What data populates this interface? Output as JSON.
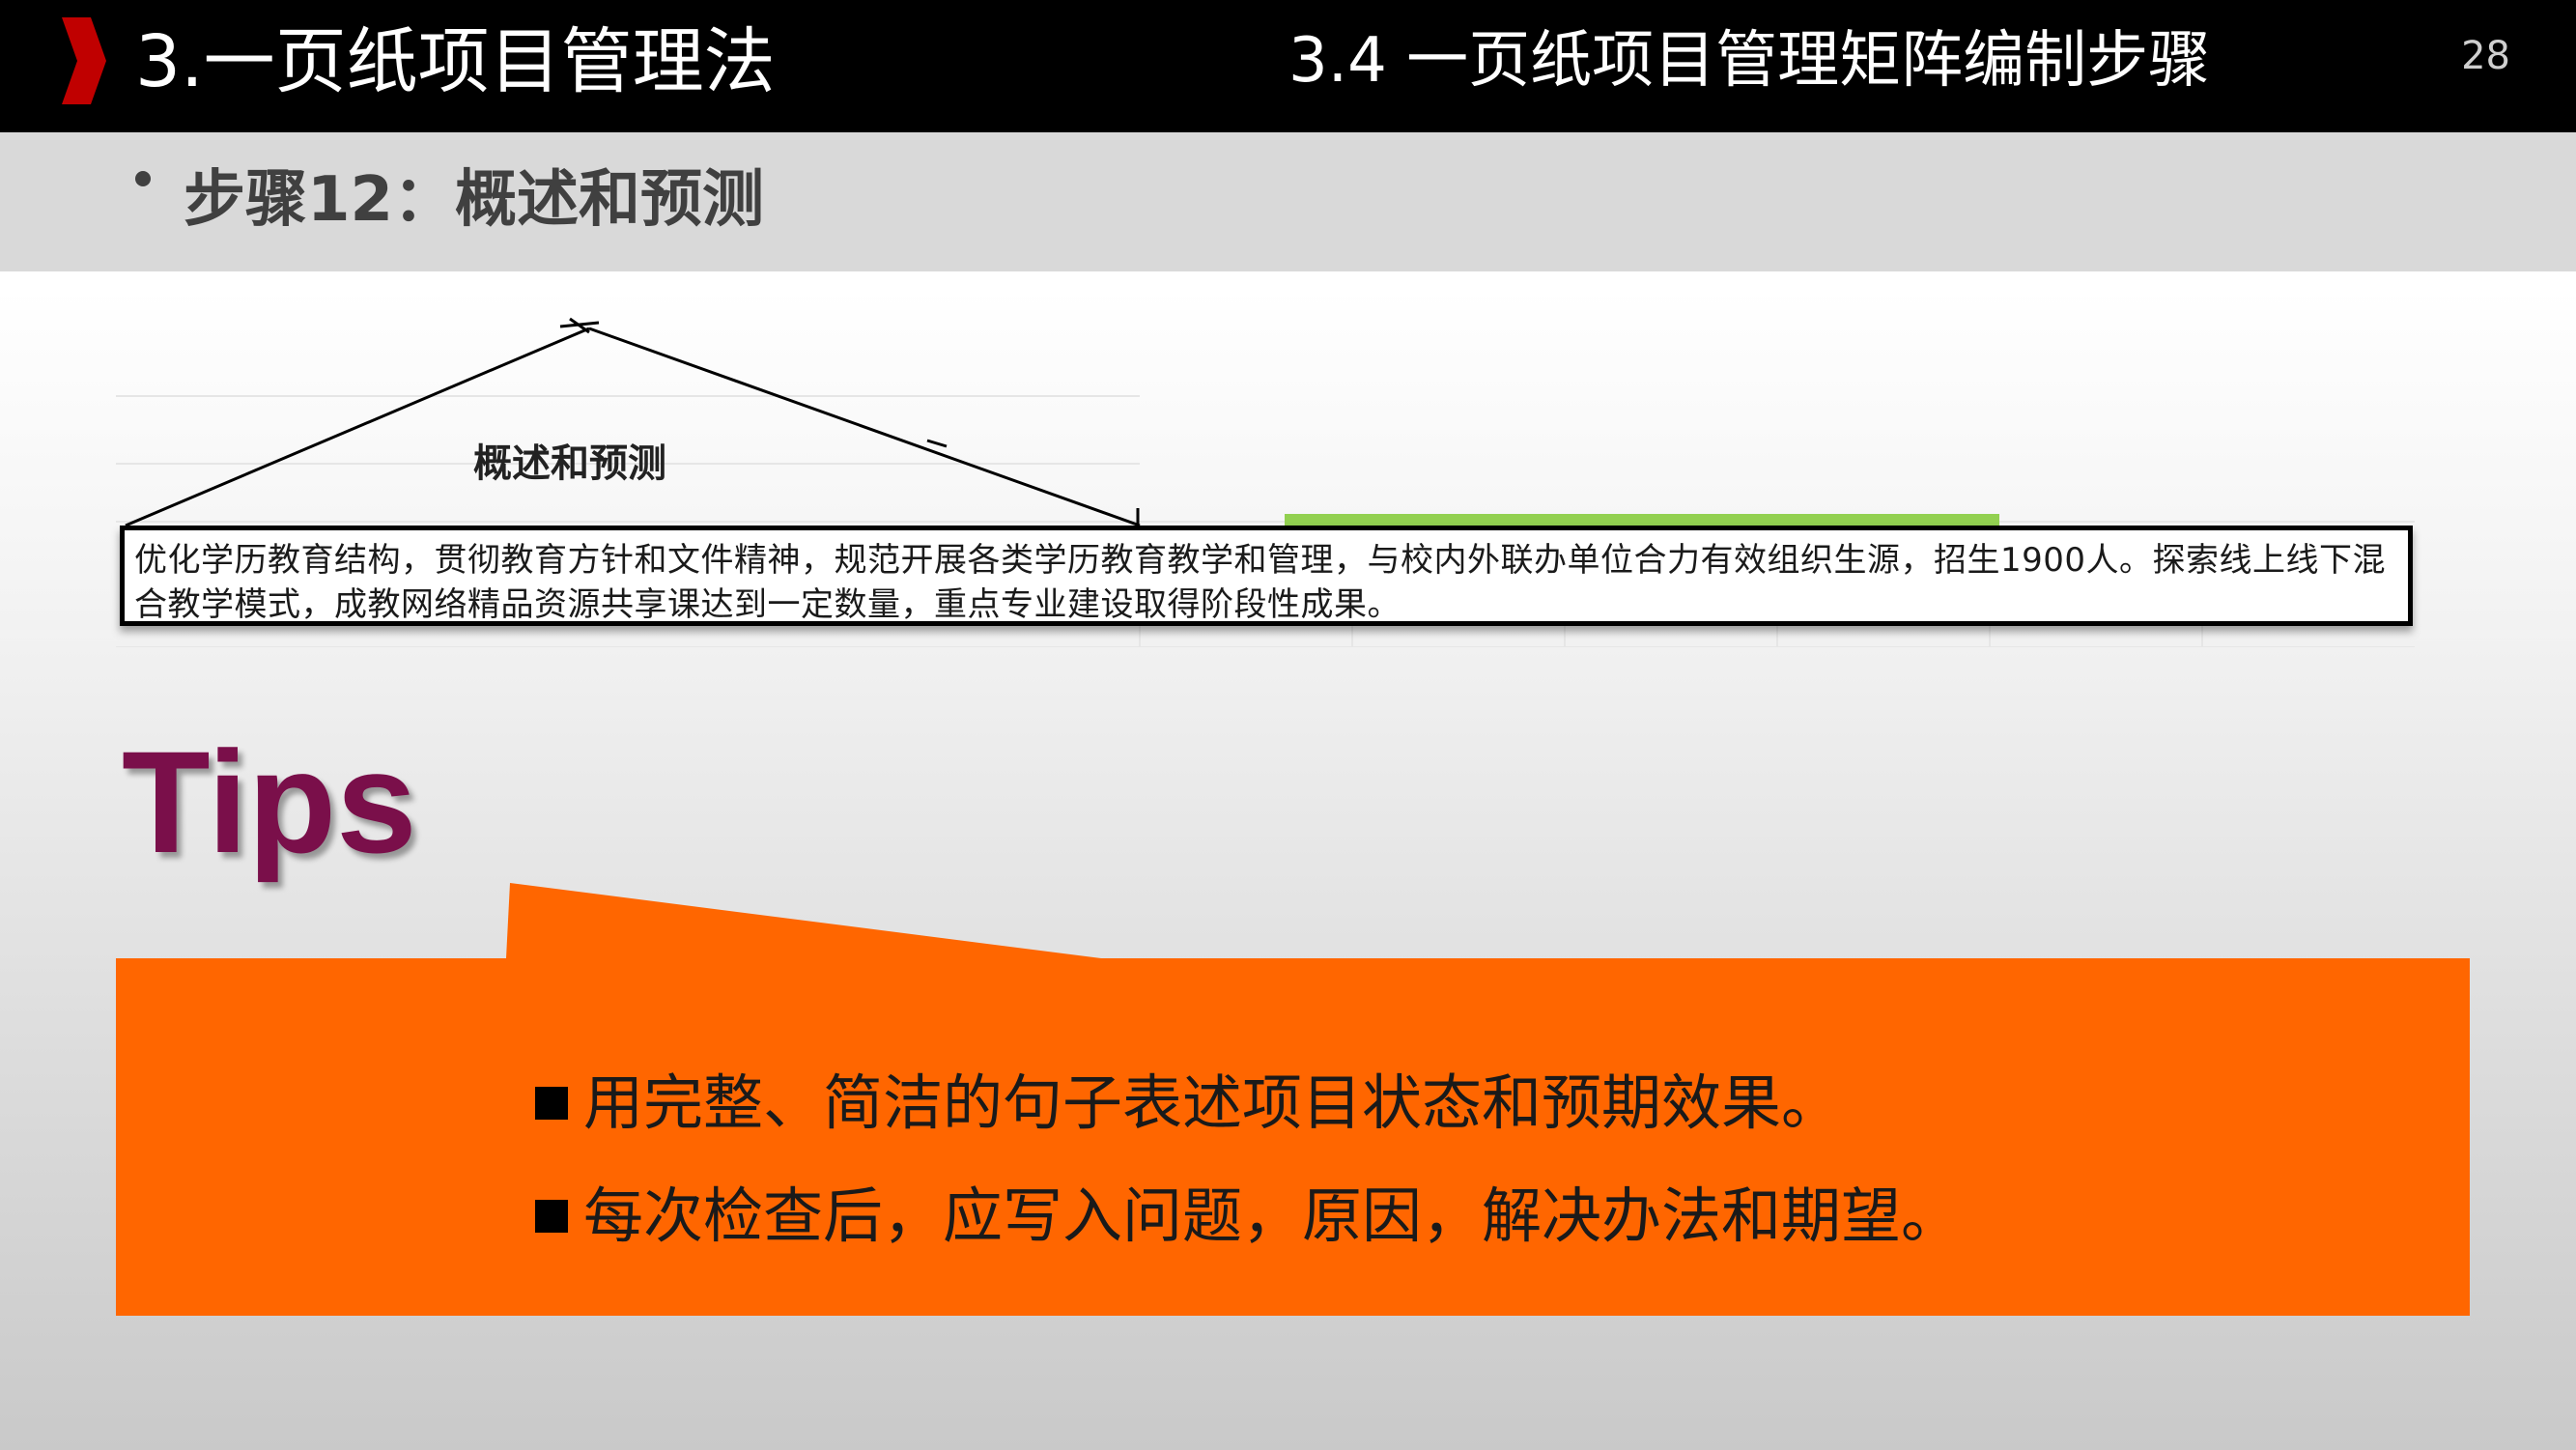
{
  "header": {
    "title": "3.一页纸项目管理法",
    "subtitle": "3.4 一页纸项目管理矩阵编制步骤",
    "page_number": "28"
  },
  "step": {
    "label": "步骤12：概述和预测"
  },
  "sheet": {
    "overview_label": "概述和预测",
    "summary_text": "优化学历教育结构，贯彻教育方针和文件精神，规范开展各类学历教育教学和管理，与校内外联办单位合力有效组织生源，招生1900人。探索线上线下混合教学模式，成教网络精品资源共享课达到一定数量，重点专业建设取得阶段性成果。"
  },
  "tips": {
    "title": "Tips",
    "items": [
      "用完整、简洁的句子表述项目状态和预期效果。",
      "每次检查后，应写入问题，原因，解决办法和期望。"
    ]
  },
  "colors": {
    "header_bg": "#000000",
    "header_arrow": "#c00000",
    "step_band": "#d9d9d9",
    "tips_title": "#7a0f4a",
    "tips_box": "#ff6600",
    "green_bar": "#92d050"
  },
  "icons": {
    "header_marker": "red-chevron-icon",
    "bullet": "bullet-dot-icon",
    "tip_marker": "black-square-icon"
  }
}
